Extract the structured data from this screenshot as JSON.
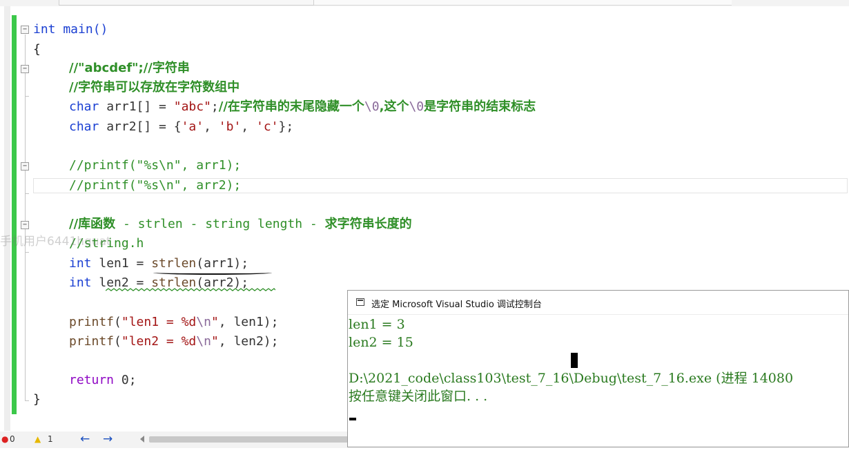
{
  "code": {
    "line_main": "int main()",
    "open_brace": "{",
    "c1": "//\"abcdef\";//字符串",
    "c2": "//字符串可以存放在字符数组中",
    "decl1": {
      "type": "char",
      "rest": " arr1[] = ",
      "str": "\"abc\"",
      "semi": ";",
      "comment_a": "//在字符串的末尾隐藏一个",
      "esc1": "\\0",
      "comment_b": ",这个",
      "esc2": "\\0",
      "comment_c": "是字符串的结束标志"
    },
    "decl2": {
      "type": "char",
      "rest": " arr2[] = {",
      "a": "'a'",
      "sep1": ", ",
      "b": "'b'",
      "sep2": ", ",
      "c": "'c'",
      "end": "};"
    },
    "c3": "//printf(\"%s\\n\", arr1);",
    "c4": "//printf(\"%s\\n\", arr2);",
    "c5a": "//库函数",
    "c5b": " - strlen - string length - ",
    "c5c": "求字符串长度的",
    "c6": "//string.h",
    "len1": {
      "type": "int",
      "rest": " len1 = ",
      "fn": "strlen",
      "args": "(arr1);"
    },
    "len2": {
      "type": "int",
      "rest": " len2 = ",
      "fn": "strlen",
      "args": "(arr2);"
    },
    "p1": {
      "fn": "printf",
      "open": "(",
      "str": "\"len1 = %d",
      "esc": "\\n",
      "strend": "\"",
      "rest": ", len1);"
    },
    "p2": {
      "fn": "printf",
      "open": "(",
      "str": "\"len2 = %d",
      "esc": "\\n",
      "strend": "\"",
      "rest": ", len2);"
    },
    "ret": {
      "kw": "return",
      "rest": " 0;"
    },
    "close_brace": "}"
  },
  "watermark": "手机用户6441hquat",
  "status": {
    "errors": "0",
    "warnings": "1",
    "back": "←",
    "forward": "→"
  },
  "console": {
    "title": "选定 Microsoft Visual Studio 调试控制台",
    "line1": "len1 = 3",
    "line2": "len2 = 15",
    "line3": "D:\\2021_code\\class103\\test_7_16\\Debug\\test_7_16.exe (进程 14080",
    "line4": "按任意键关闭此窗口. . ."
  },
  "colors": {
    "keyword": "#1a3fd2",
    "string": "#a31515",
    "comment": "#2f8f28",
    "change_bar": "#3cc84a",
    "console_text": "#2a7a1f"
  }
}
